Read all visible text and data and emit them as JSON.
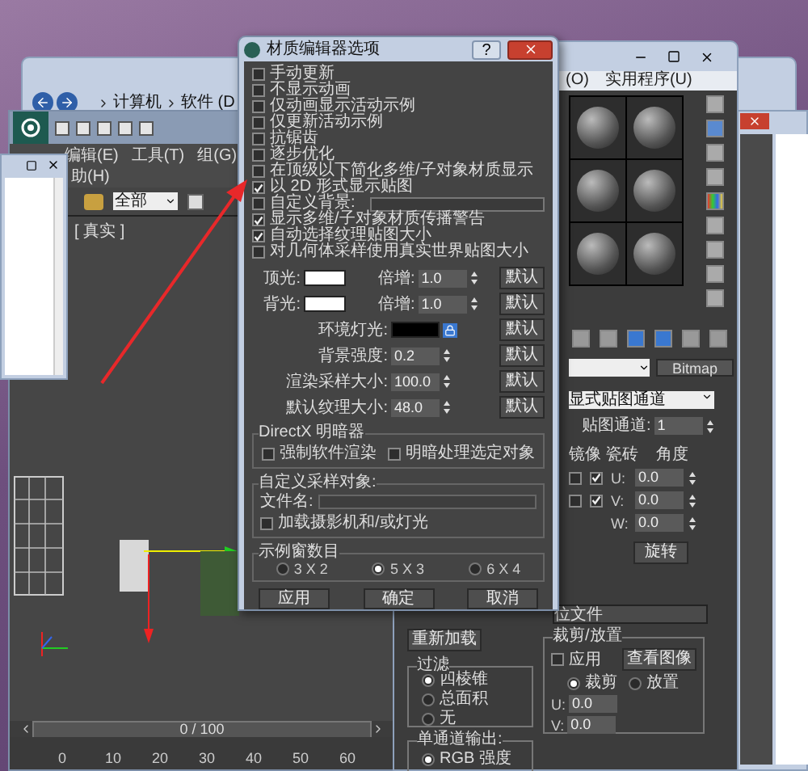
{
  "explorer": {
    "breadcrumb": [
      "计算机",
      "软件 (D"
    ]
  },
  "max_window": {
    "menu": [
      "编辑(E)",
      "工具(T)",
      "组(G)"
    ],
    "menu_row2": [
      "助(H)"
    ],
    "filter": "全部",
    "viewport_label": "[ 真实 ]",
    "time_slider": "0 / 100",
    "ruler_ticks": [
      "0",
      "10",
      "20",
      "30",
      "40",
      "50",
      "60"
    ]
  },
  "material_editor": {
    "menu": [
      "(O)",
      "实用程序(U)"
    ],
    "map_type": "Bitmap",
    "map_channel_mode": "显式贴图通道",
    "map_channel_label": "贴图通道:",
    "map_channel": "1",
    "tiling_headers": [
      "镜像",
      "瓷砖",
      "角度"
    ],
    "coords": [
      {
        "kind": "tiling",
        "axis": "U:",
        "value": "0.0",
        "mirror": false,
        "tile": true
      },
      {
        "kind": "tiling",
        "axis": "V:",
        "value": "0.0",
        "mirror": false,
        "tile": true
      },
      {
        "kind": "plain",
        "axis": "W:",
        "value": "0.0"
      }
    ],
    "rotate_button": "旋转",
    "bitmap_field": "位文件",
    "reload_button": "重新加载",
    "filter_group": {
      "title": "过滤",
      "options": [
        {
          "label": "四棱锥",
          "selected": true
        },
        {
          "label": "总面积",
          "selected": false
        },
        {
          "label": "无",
          "selected": false
        }
      ]
    },
    "mono_output": {
      "title": "单通道输出:",
      "options": [
        {
          "label": "RGB 强度",
          "selected": true
        }
      ]
    },
    "crop_group": {
      "title": "裁剪/放置",
      "apply": {
        "label": "应用",
        "checked": false
      },
      "view_button": "查看图像",
      "modes": [
        {
          "label": "裁剪",
          "selected": true
        },
        {
          "label": "放置",
          "selected": false
        }
      ],
      "fields": [
        {
          "axis": "U:",
          "value": "0.0"
        },
        {
          "axis": "V:",
          "value": "0.0"
        }
      ]
    }
  },
  "dialog": {
    "title": "材质编辑器选项",
    "help_button": "?",
    "options": [
      {
        "kind": "check",
        "label": "手动更新",
        "checked": false
      },
      {
        "kind": "check",
        "label": "不显示动画",
        "checked": false
      },
      {
        "kind": "check",
        "label": "仅动画显示活动示例",
        "checked": false
      },
      {
        "kind": "check",
        "label": "仅更新活动示例",
        "checked": false
      },
      {
        "kind": "check",
        "label": "抗锯齿",
        "checked": false
      },
      {
        "kind": "check",
        "label": "逐步优化",
        "checked": false
      },
      {
        "kind": "check",
        "label": "在顶级以下简化多维/子对象材质显示",
        "checked": false
      },
      {
        "kind": "check",
        "label": "以 2D 形式显示贴图",
        "checked": true
      },
      {
        "kind": "check_field",
        "label": "自定义背景:",
        "checked": false
      },
      {
        "kind": "check",
        "label": "显示多维/子对象材质传播警告",
        "checked": true
      },
      {
        "kind": "check",
        "label": "自动选择纹理贴图大小",
        "checked": true
      },
      {
        "kind": "check",
        "label": "对几何体采样使用真实世界贴图大小",
        "checked": false
      }
    ],
    "lights": [
      {
        "label": "顶光:",
        "color": "#ffffff",
        "multiplier_label": "倍增:",
        "multiplier": "1.0",
        "default_button": "默认"
      },
      {
        "label": "背光:",
        "color": "#ffffff",
        "multiplier_label": "倍增:",
        "multiplier": "1.0",
        "default_button": "默认"
      }
    ],
    "settings": [
      {
        "kind": "color",
        "label": "环境灯光:",
        "color": "#000000",
        "default_button": "默认"
      },
      {
        "kind": "spinner",
        "label": "背景强度:",
        "value": "0.2",
        "default_button": "默认"
      },
      {
        "kind": "spinner",
        "label": "渲染采样大小:",
        "value": "100.0",
        "default_button": "默认"
      },
      {
        "kind": "spinner",
        "label": "默认纹理大小:",
        "value": "48.0",
        "default_button": "默认"
      }
    ],
    "directx": {
      "title": "DirectX 明暗器",
      "options": [
        {
          "label": "强制软件渲染",
          "checked": false
        },
        {
          "label": "明暗处理选定对象",
          "checked": false
        }
      ]
    },
    "custom_sample": {
      "title": "自定义采样对象:",
      "file_label": "文件名:",
      "load": {
        "label": "加载摄影机和/或灯光",
        "checked": false
      }
    },
    "slots": {
      "title": "示例窗数目",
      "options": [
        {
          "label": "3 X 2",
          "selected": false
        },
        {
          "label": "5 X 3",
          "selected": true
        },
        {
          "label": "6 X 4",
          "selected": false
        }
      ]
    },
    "buttons": [
      "应用",
      "确定",
      "取消"
    ]
  }
}
